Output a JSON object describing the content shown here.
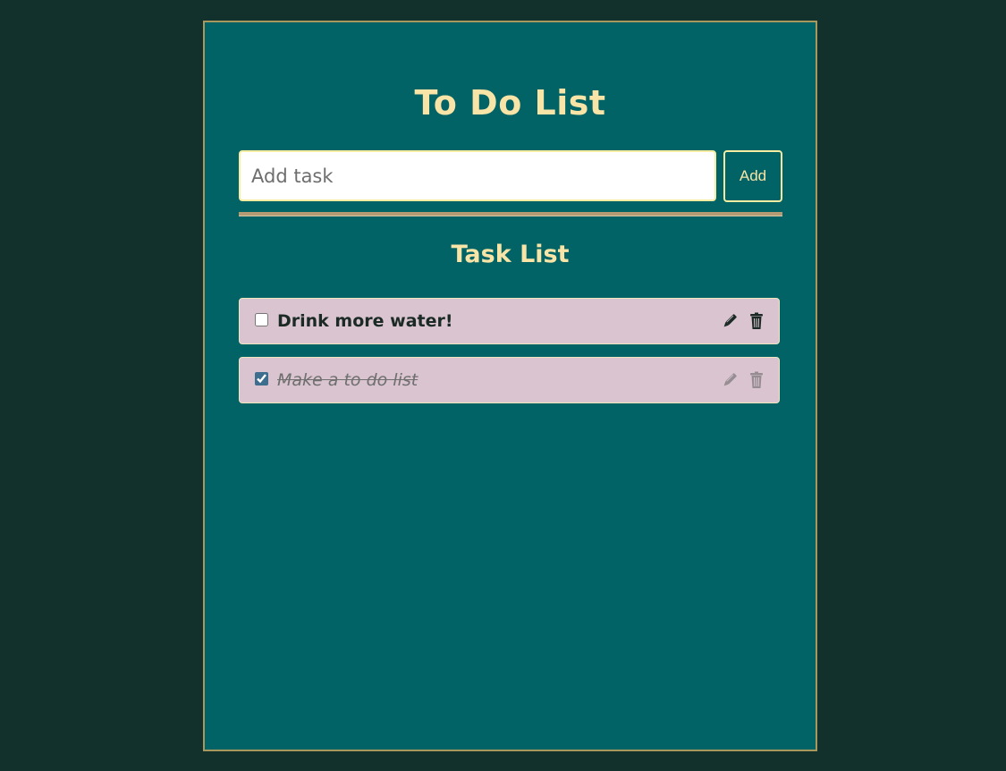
{
  "header": {
    "title": "To Do List"
  },
  "input": {
    "placeholder": "Add task",
    "value": ""
  },
  "add_button": {
    "label": "Add"
  },
  "list": {
    "title": "Task List",
    "tasks": [
      {
        "text": "Drink more water!",
        "completed": false,
        "edit_icon": "pen-icon",
        "delete_icon": "trash-icon"
      },
      {
        "text": "Make a to do list",
        "completed": true,
        "edit_icon": "pen-icon",
        "delete_icon": "trash-icon"
      }
    ]
  },
  "colors": {
    "page_background": "#12302c",
    "panel_background": "#016365",
    "accent_text": "#f8e4a6",
    "task_background": "#d9c4cf"
  }
}
